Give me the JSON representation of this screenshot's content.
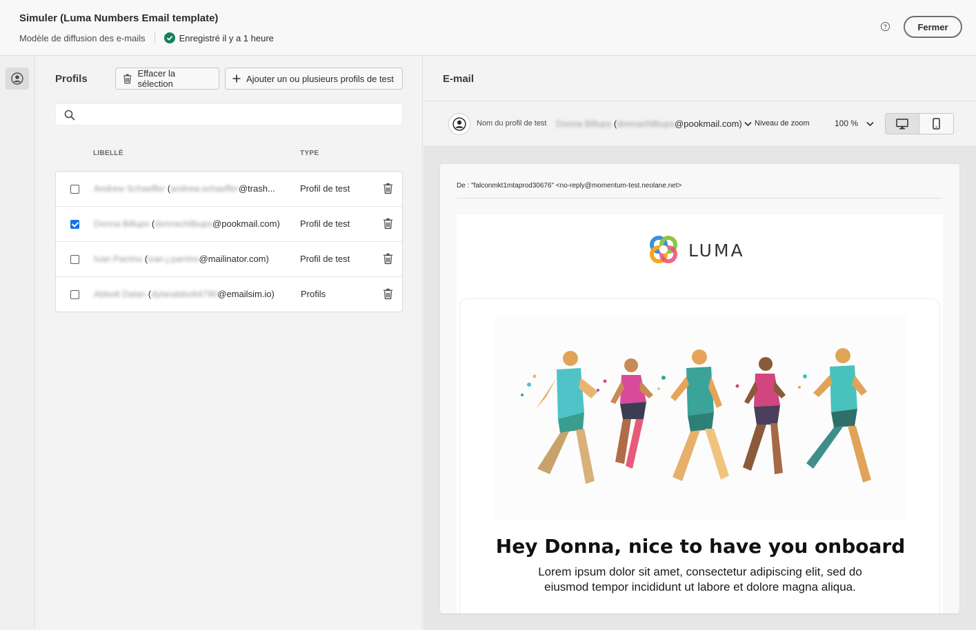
{
  "header": {
    "title": "Simuler (Luma Numbers Email template)",
    "subtitle": "Modèle de diffusion des e-mails",
    "saved_status": "Enregistré il y a 1 heure",
    "close_label": "Fermer"
  },
  "profiles": {
    "title": "Profils",
    "clear_selection_label": "Effacer la sélection",
    "add_profiles_label": "Ajouter un ou plusieurs profils de test",
    "search_placeholder": "",
    "columns": {
      "label": "LIBELLÉ",
      "type": "TYPE"
    },
    "rows": [
      {
        "name_blurred": "Andrew Schaeffer",
        "open": "(",
        "email_blurred": "andrew.schaeffer",
        "email_visible": "@trash...",
        "close": "",
        "type": "Profil de test",
        "checked": false
      },
      {
        "name_blurred": "Donna Billups",
        "open": "(",
        "email_blurred": "donnachilbups",
        "email_visible": "@pookmail.com",
        "close": ")",
        "type": "Profil de test",
        "checked": true
      },
      {
        "name_blurred": "Ivan Parrino",
        "open": "(",
        "email_blurred": "ivan.j.parrino",
        "email_visible": "@mailinator.com",
        "close": ")",
        "type": "Profil de test",
        "checked": false
      },
      {
        "name_blurred": "Abbott Dalan",
        "open": "(",
        "email_blurred": "dylanabbott4790",
        "email_visible": "@emailsim.io",
        "close": ")",
        "type": "Profils",
        "checked": false
      }
    ]
  },
  "email": {
    "title": "E-mail",
    "test_profile_label": "Nom du profil de test",
    "test_profile_name_blurred": "Donna Billups",
    "test_profile_email_blurred": "donnachilbups",
    "test_profile_email_visible": "@pookmail.com)",
    "zoom_label": "Niveau de zoom",
    "zoom_value": "100 %",
    "from_line": "De : \"falconmkt1mtaprod30676\" <no-reply@momentum-test.neolane.net>",
    "brand": "LUMA",
    "headline": "Hey Donna, nice to have you onboard",
    "body_text": "Lorem ipsum dolor sit amet, consectetur adipiscing elit, sed do eiusmod tempor incididunt ut labore et dolore magna aliqua."
  },
  "colors": {
    "accent": "#1473e6",
    "success": "#12805c"
  }
}
